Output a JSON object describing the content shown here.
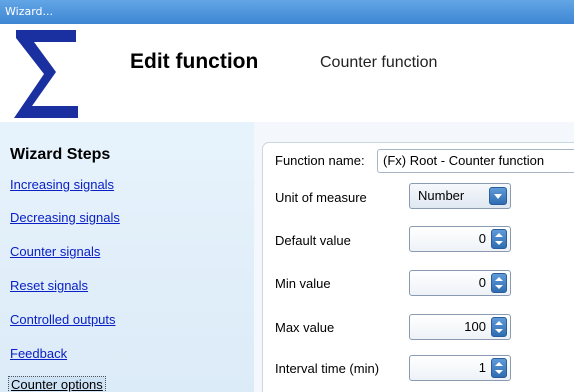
{
  "window": {
    "title": "Wizard..."
  },
  "header": {
    "title": "Edit function",
    "subtitle": "Counter function",
    "logo_icon": "sigma-icon"
  },
  "sidebar": {
    "title": "Wizard Steps",
    "items": [
      {
        "label": "Increasing signals"
      },
      {
        "label": "Decreasing signals"
      },
      {
        "label": "Counter signals"
      },
      {
        "label": "Reset signals"
      },
      {
        "label": "Controlled outputs"
      },
      {
        "label": "Feedback"
      },
      {
        "label": "Counter options",
        "active": true
      }
    ]
  },
  "form": {
    "function_name": {
      "label": "Function name:",
      "value": "(Fx) Root - Counter function"
    },
    "unit_of_measure": {
      "label": "Unit of measure",
      "value": "Number"
    },
    "default_value": {
      "label": "Default value",
      "value": "0"
    },
    "min_value": {
      "label": "Min value",
      "value": "0"
    },
    "max_value": {
      "label": "Max value",
      "value": "100"
    },
    "interval_time": {
      "label": "Interval time (min)",
      "value": "1"
    }
  },
  "colors": {
    "titlebar": "#3e86d3",
    "link": "#0a20c4",
    "sidebar_bg": "#e1eefa",
    "sigma": "#1a2fa0"
  }
}
